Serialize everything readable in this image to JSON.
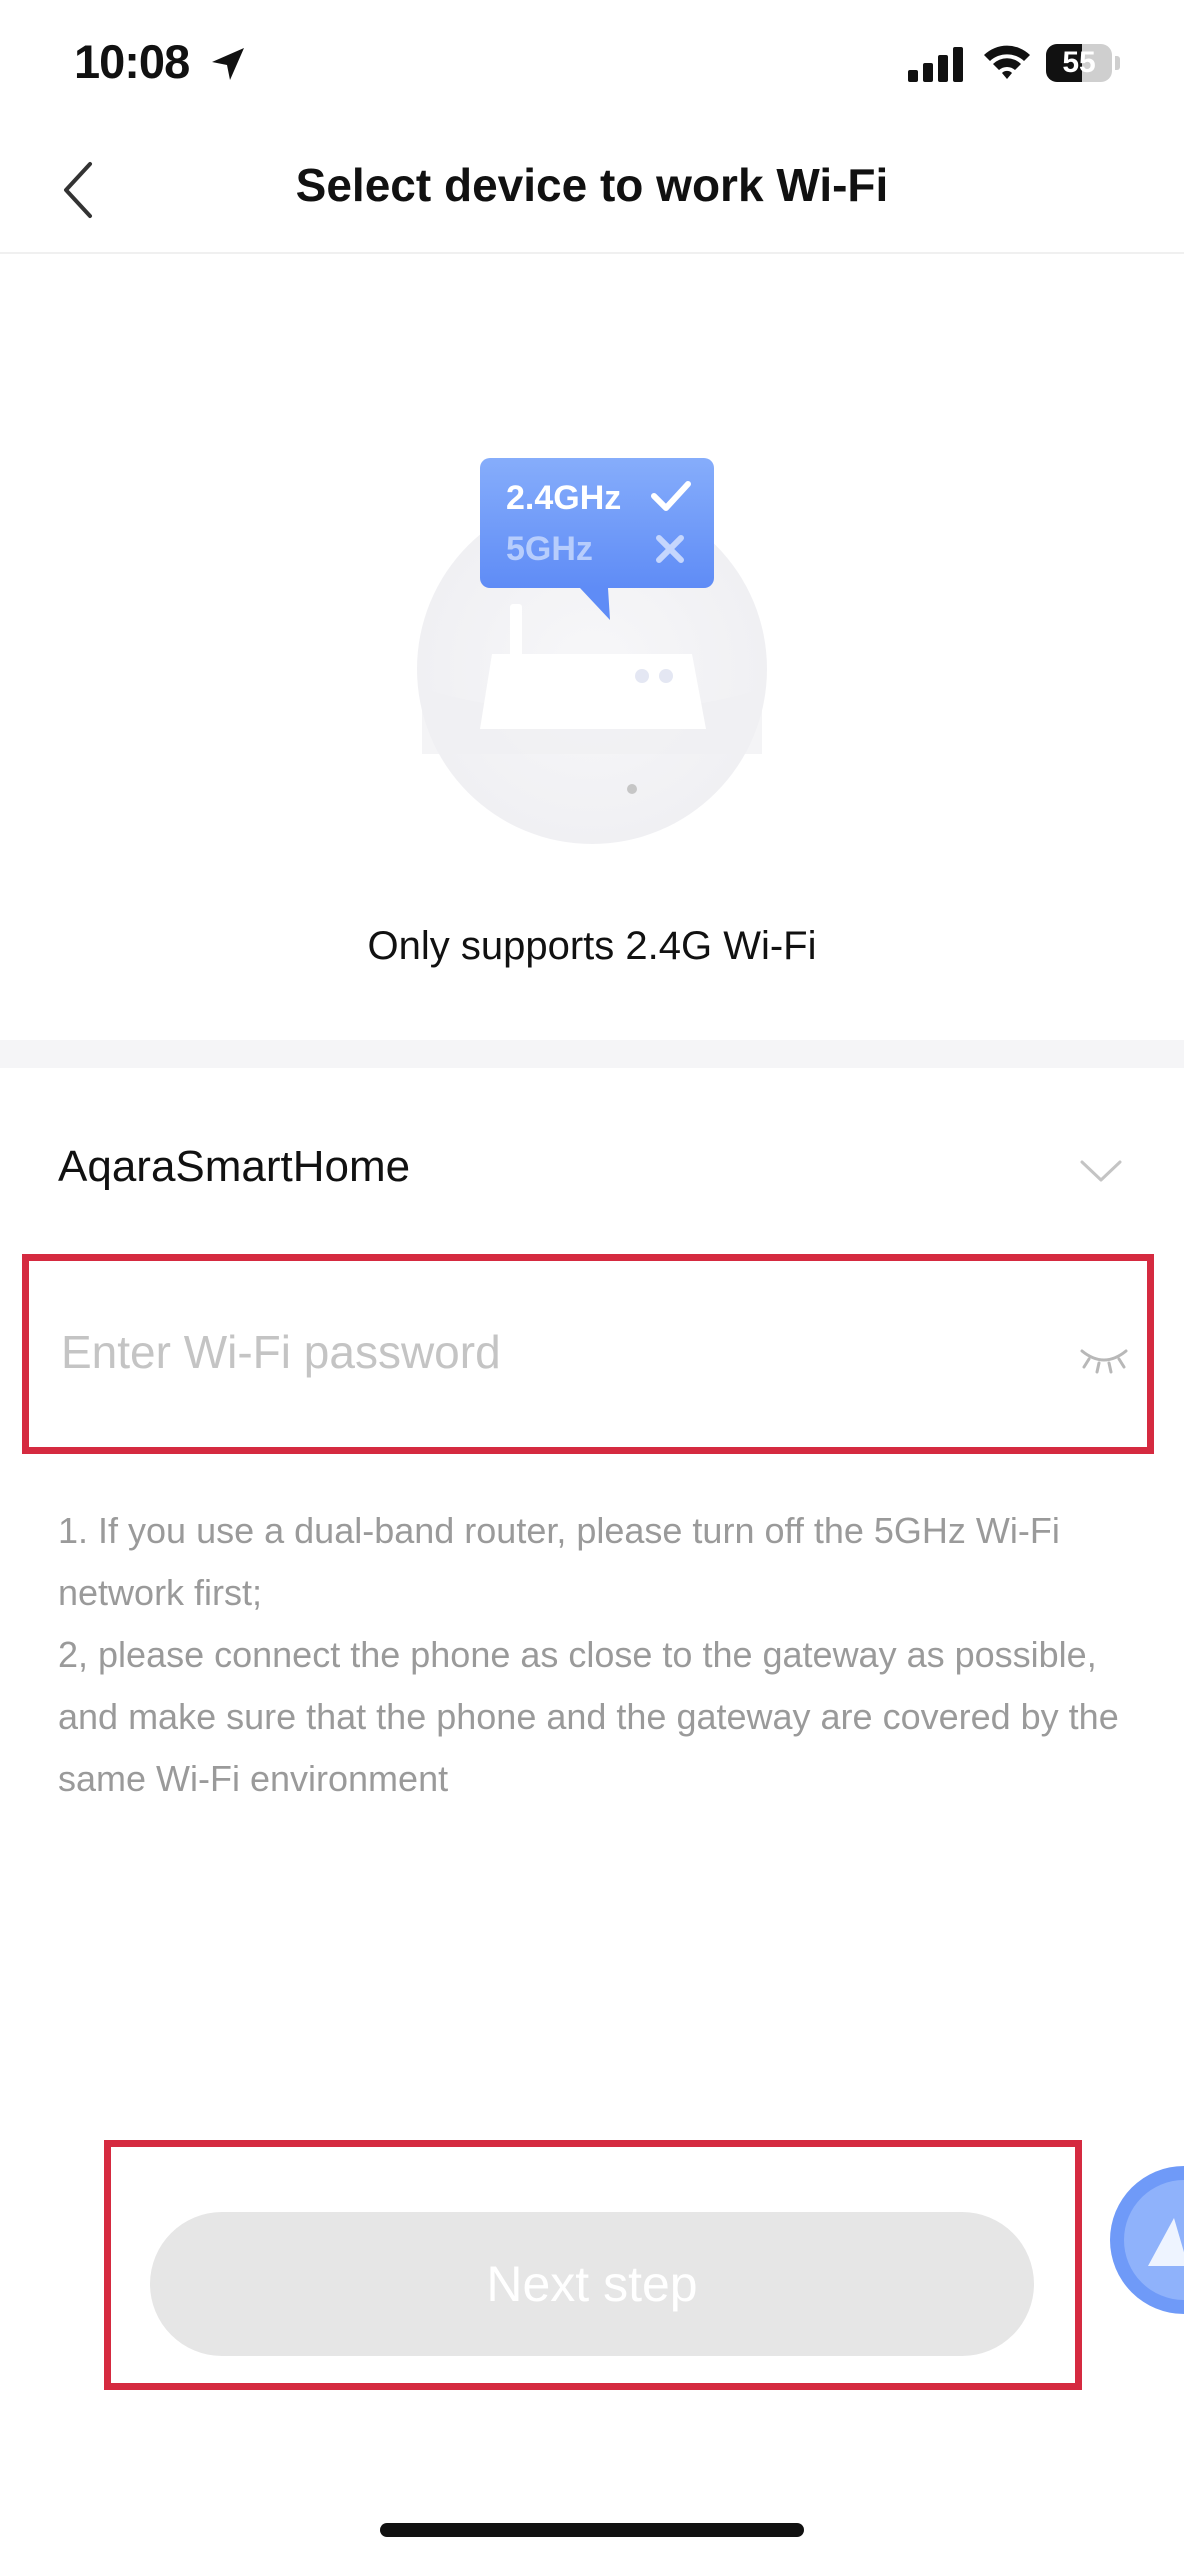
{
  "status_bar": {
    "time": "10:08",
    "battery_level": "55",
    "battery_fraction": 0.55
  },
  "nav": {
    "title": "Select device to work Wi-Fi",
    "back_icon": "chevron-left-icon"
  },
  "illustration": {
    "band_24": "2.4GHz",
    "band_5": "5GHz",
    "accent_color": "#6f9af8"
  },
  "hero": {
    "caption": "Only supports 2.4G Wi-Fi"
  },
  "form": {
    "wifi_name": "AqaraSmartHome",
    "password_value": "",
    "password_placeholder": "Enter Wi-Fi password"
  },
  "tips": [
    "1. If you use a dual-band router, please turn off the 5GHz Wi-Fi network first;",
    "2, please connect the phone as close to the gateway as possible, and make sure that the phone and the gateway are covered by the same Wi-Fi environment"
  ],
  "footer": {
    "next_label": "Next step"
  },
  "colors": {
    "highlight": "#d52a40",
    "button_disabled": "#e6e6e6"
  }
}
